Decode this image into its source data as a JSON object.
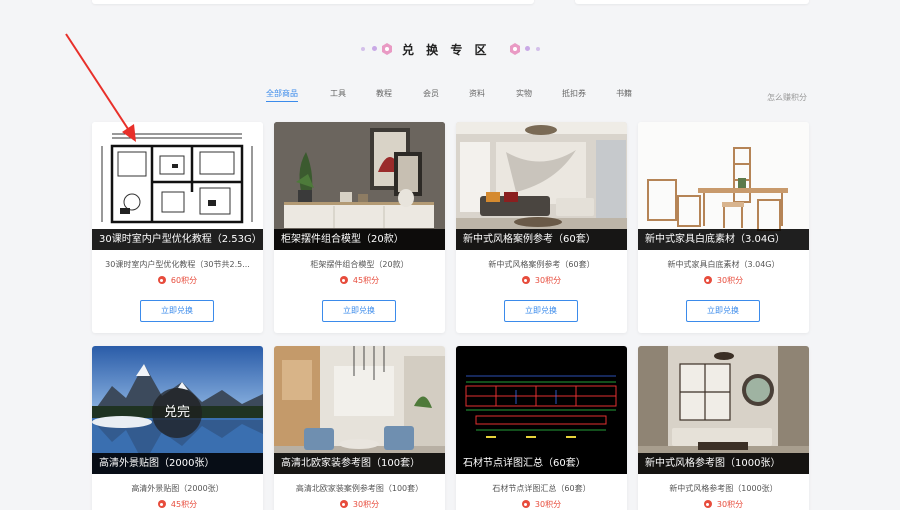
{
  "section": {
    "title": "兑 换 专 区"
  },
  "tabs": [
    {
      "label": "全部商品",
      "active": true
    },
    {
      "label": "工具"
    },
    {
      "label": "教程"
    },
    {
      "label": "会员"
    },
    {
      "label": "资料"
    },
    {
      "label": "实物"
    },
    {
      "label": "抵扣券"
    },
    {
      "label": "书籍"
    }
  ],
  "earn_points_link": "怎么赚积分",
  "exchange_label": "立即兑换",
  "products": [
    {
      "caption": "30课时室内户型优化教程（2.53G）",
      "desc": "30课时室内户型优化教程（30节共2.5...",
      "points": "60积分"
    },
    {
      "caption": "柜架摆件组合模型（20款）",
      "desc": "柜架摆件组合模型（20款）",
      "points": "45积分"
    },
    {
      "caption": "新中式风格案例参考（60套）",
      "desc": "新中式风格案例参考（60套）",
      "points": "30积分"
    },
    {
      "caption": "新中式家具白底素材（3.04G）",
      "desc": "新中式家具白底素材（3.04G）",
      "points": "30积分"
    },
    {
      "caption": "高清外景贴图（2000张）",
      "desc": "高清外景贴图（2000张）",
      "points": "45积分",
      "badge": "兑完"
    },
    {
      "caption": "高清北欧家装参考图（100套）",
      "desc": "高清北欧家装案例参考图（100套）",
      "points": "30积分"
    },
    {
      "caption": "石材节点详图汇总（60套）",
      "desc": "石材节点详图汇总（60套）",
      "points": "30积分"
    },
    {
      "caption": "新中式风格参考图（1000张）",
      "desc": "新中式风格参考图（1000张）",
      "points": "30积分"
    }
  ],
  "colors": {
    "accent": "#3b8beb",
    "points": "#e74c3c",
    "caption_bg": "#000000",
    "annotation_arrow": "#e8302a"
  }
}
